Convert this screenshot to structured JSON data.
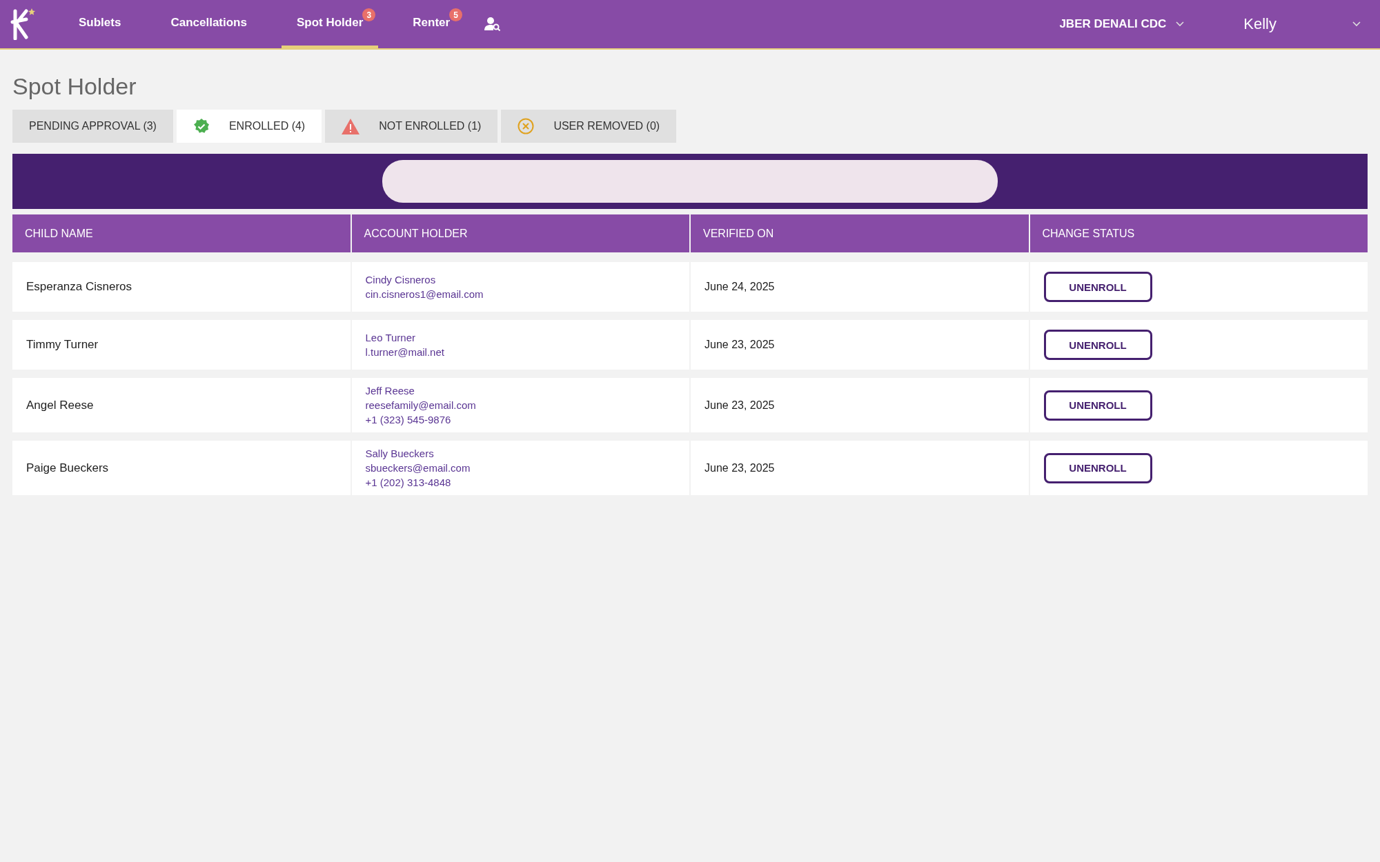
{
  "nav": {
    "items": [
      {
        "label": "Sublets",
        "selected": false
      },
      {
        "label": "Cancellations",
        "selected": false
      },
      {
        "label": "Spot Holder",
        "selected": true,
        "badge": "3"
      },
      {
        "label": "Renter",
        "selected": false,
        "badge": "5"
      }
    ],
    "location": "JBER DENALI CDC",
    "user": "Kelly"
  },
  "page_title": "Spot Holder",
  "tabs": [
    {
      "label": "PENDING APPROVAL (3)",
      "selected": false,
      "kind": "none"
    },
    {
      "label": "ENROLLED (4)",
      "selected": true,
      "kind": "check"
    },
    {
      "label": "NOT ENROLLED (1)",
      "selected": false,
      "kind": "warning"
    },
    {
      "label": "USER REMOVED (0)",
      "selected": false,
      "kind": "removed"
    }
  ],
  "table": {
    "columns": [
      "CHILD NAME",
      "ACCOUNT HOLDER",
      "VERIFIED ON",
      "CHANGE STATUS"
    ],
    "rows": [
      {
        "child": "Esperanza Cisneros",
        "holder": [
          "Cindy Cisneros",
          "cin.cisneros1@email.com"
        ],
        "verified": "June 24, 2025",
        "action": "UNENROLL"
      },
      {
        "child": "Timmy Turner",
        "holder": [
          "Leo Turner",
          "l.turner@mail.net"
        ],
        "verified": "June 23, 2025",
        "action": "UNENROLL"
      },
      {
        "child": "Angel Reese",
        "holder": [
          "Jeff Reese",
          "reesefamily@email.com",
          "+1 (323) 545-9876"
        ],
        "verified": "June 23, 2025",
        "action": "UNENROLL"
      },
      {
        "child": "Paige Bueckers",
        "holder": [
          "Sally Bueckers",
          "sbueckers@email.com",
          "+1 (202) 313-4848"
        ],
        "verified": "June 23, 2025",
        "action": "UNENROLL"
      }
    ]
  }
}
